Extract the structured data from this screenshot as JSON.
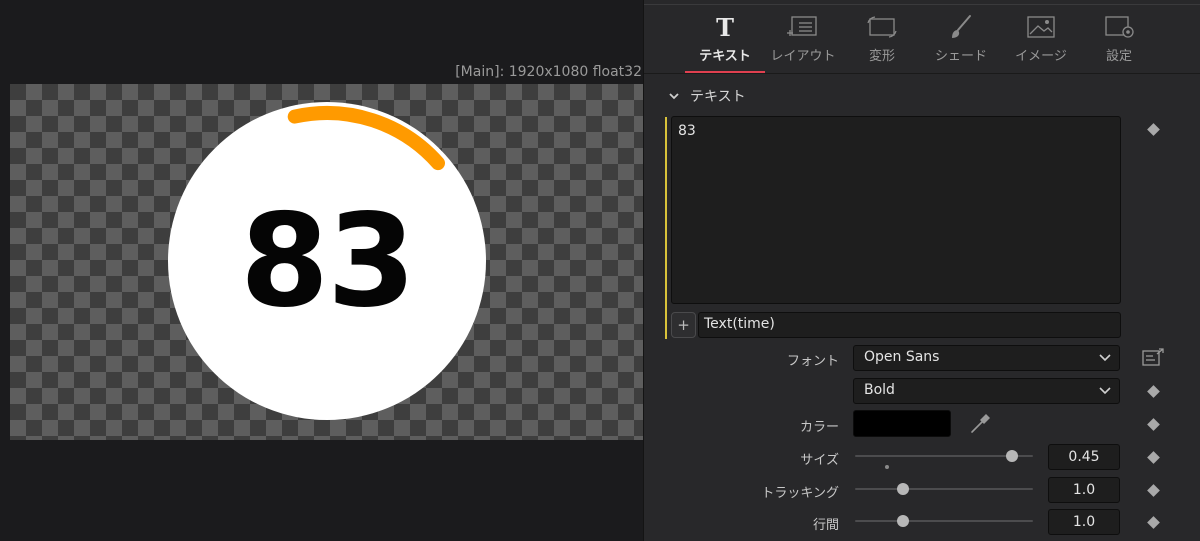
{
  "viewer": {
    "info": "[Main]: 1920x1080 float32",
    "dial_number": "83",
    "dial_progress_fraction": 0.17,
    "arc_color": "#ff9a00",
    "dial_color": "#ffffff"
  },
  "tabs": [
    {
      "label": "テキスト",
      "icon": "text-T-icon",
      "active": true
    },
    {
      "label": "レイアウト",
      "icon": "layout-icon",
      "active": false
    },
    {
      "label": "変形",
      "icon": "transform-icon",
      "active": false
    },
    {
      "label": "シェード",
      "icon": "brush-icon",
      "active": false
    },
    {
      "label": "イメージ",
      "icon": "image-icon",
      "active": false
    },
    {
      "label": "設定",
      "icon": "settings-icon",
      "active": false
    }
  ],
  "accent_color": "#e04050",
  "section": {
    "title": "テキスト"
  },
  "text_field": {
    "value": "83"
  },
  "expression": {
    "plus": "+",
    "value": "Text(time)"
  },
  "font": {
    "label": "フォント",
    "family": "Open Sans",
    "style": "Bold"
  },
  "color": {
    "label": "カラー",
    "value": "#000000"
  },
  "size": {
    "label": "サイズ",
    "value": "0.45",
    "fraction": 0.88,
    "default_fraction": 0.18
  },
  "tracking": {
    "label": "トラッキング",
    "value": "1.0",
    "fraction": 0.27
  },
  "line_spacing": {
    "label": "行間",
    "value": "1.0",
    "fraction": 0.27
  }
}
